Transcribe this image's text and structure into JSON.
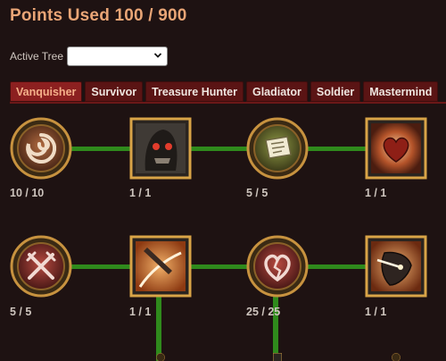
{
  "header": {
    "title": "Points Used 100 / 900"
  },
  "tree_select": {
    "label": "Active Tree",
    "value": ""
  },
  "tabs": [
    {
      "label": "Vanquisher",
      "active": true
    },
    {
      "label": "Survivor",
      "active": false
    },
    {
      "label": "Treasure Hunter",
      "active": false
    },
    {
      "label": "Gladiator",
      "active": false
    },
    {
      "label": "Soldier",
      "active": false
    },
    {
      "label": "Mastermind",
      "active": false
    }
  ],
  "nodes": [
    {
      "icon": "swirl-icon",
      "rank": "10 / 10"
    },
    {
      "icon": "skull-warrior-icon",
      "rank": "1 / 1"
    },
    {
      "icon": "scroll-icon",
      "rank": "5 / 5"
    },
    {
      "icon": "heart-icon",
      "rank": "1 / 1"
    },
    {
      "icon": "crossed-blades-icon",
      "rank": "5 / 5"
    },
    {
      "icon": "dagger-slash-icon",
      "rank": "1 / 1"
    },
    {
      "icon": "broken-heart-icon",
      "rank": "25 / 25"
    },
    {
      "icon": "shield-break-icon",
      "rank": "1 / 1"
    }
  ],
  "colors": {
    "background": "#1e1212",
    "title": "#e9a576",
    "tab": "#5a1414",
    "tab_active": "#8c2020",
    "connector": "#2f8a1c",
    "frame_gold": "#d7a24a"
  }
}
